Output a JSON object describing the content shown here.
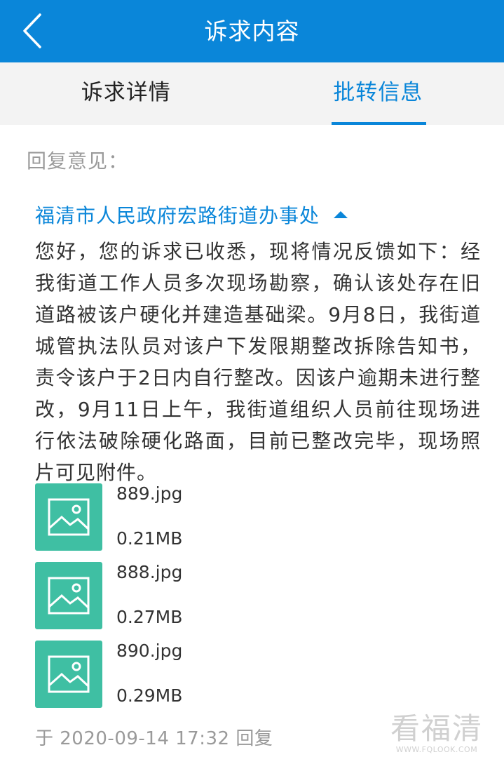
{
  "header": {
    "title": "诉求内容",
    "back_icon": "chevron-left-icon"
  },
  "tabs": [
    {
      "label": "诉求详情",
      "active": false
    },
    {
      "label": "批转信息",
      "active": true
    }
  ],
  "reply": {
    "label": "回复意见：",
    "office": "福清市人民政府宏路街道办事处",
    "content": "您好，您的诉求已收悉，现将情况反馈如下：经我街道工作人员多次现场勘察，确认该处存在旧道路被该户硬化并建造基础梁。9月8日，我街道城管执法队员对该户下发限期整改拆除告知书，责令该户于2日内自行整改。因该户逾期未进行整改，9月11日上午，我街道组织人员前往现场进行依法破除硬化路面，目前已整改完毕，现场照片可见附件。",
    "attachments": [
      {
        "name": "889.jpg",
        "size": "0.21MB",
        "icon": "image-icon"
      },
      {
        "name": "888.jpg",
        "size": "0.27MB",
        "icon": "image-icon"
      },
      {
        "name": "890.jpg",
        "size": "0.29MB",
        "icon": "image-icon"
      }
    ],
    "time": "于 2020-09-14 17:32 回复"
  },
  "watermark": {
    "main": "看福清",
    "sub": "WWW.FQLOOK.COM"
  },
  "colors": {
    "primary": "#0a86d9",
    "thumb": "#3fbfa3",
    "muted": "#9a9a9a",
    "tab_bg": "#f3f3f3"
  }
}
